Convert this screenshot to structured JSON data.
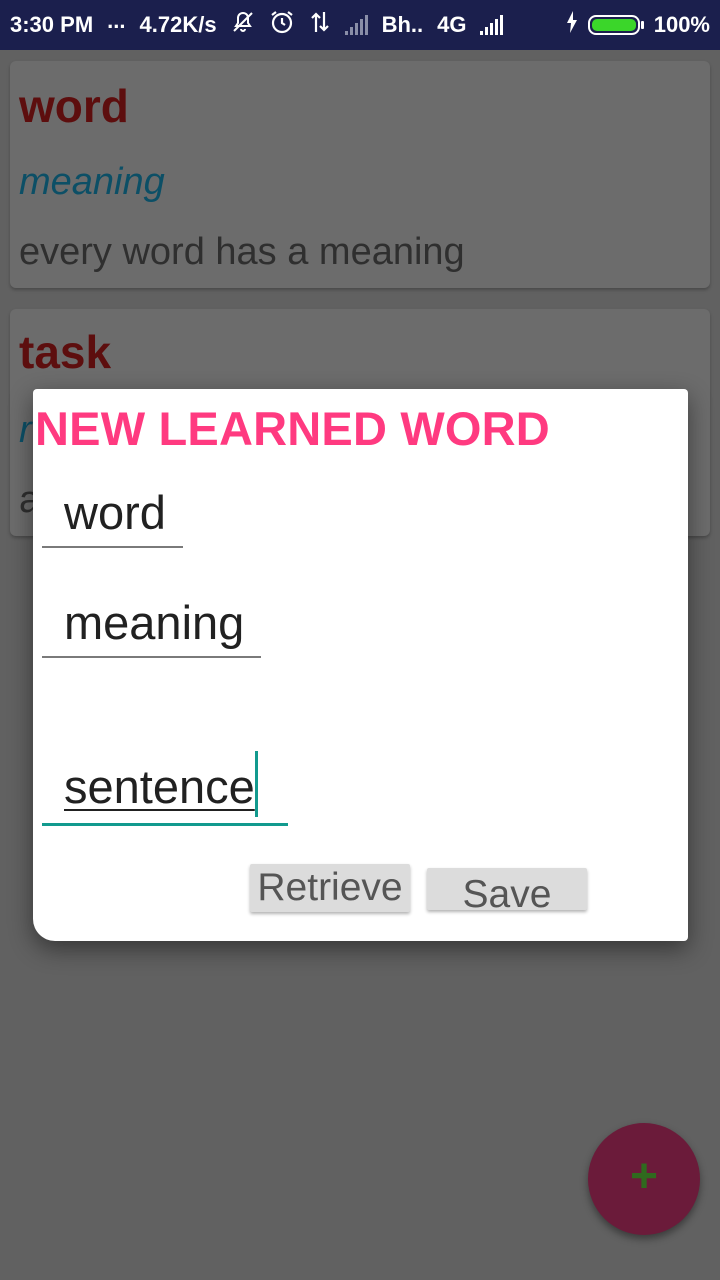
{
  "status_bar": {
    "time": "3:30 PM",
    "dots": "...",
    "speed": "4.72K/s",
    "carrier": "Bh..",
    "network": "4G",
    "battery": "100%",
    "icons": [
      "mute-bell-icon",
      "alarm-icon",
      "data-transfer-icon",
      "signal-weak-icon",
      "signal-icon",
      "charging-icon",
      "battery-icon"
    ]
  },
  "cards": [
    {
      "word": "word",
      "meaning": "meaning",
      "sentence": "every word has a meaning"
    },
    {
      "word": "task",
      "meaning": "r",
      "sentence": "a"
    }
  ],
  "dialog": {
    "title": "NEW LEARNED WORD",
    "word_value": "word",
    "meaning_value": "meaning",
    "sentence_value": "sentence",
    "retrieve_label": "Retrieve",
    "save_label": "Save"
  },
  "fab": {
    "label": "+"
  },
  "colors": {
    "accent": "#ff3a80",
    "primary_dark": "#1b1f4d",
    "word_color": "#8b0000",
    "meaning_color": "#0e6f8f",
    "input_active": "#129a8e",
    "fab_bg": "#6b1b3a",
    "fab_plus": "#2f6a1e"
  }
}
